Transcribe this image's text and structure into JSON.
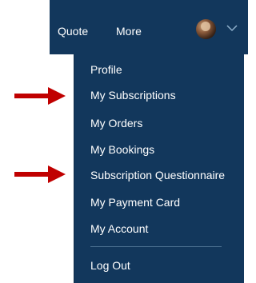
{
  "nav": {
    "quote": "Quote",
    "more": "More"
  },
  "menu": {
    "items": [
      "Profile",
      "My Subscriptions",
      "My Orders",
      "My Bookings",
      "Subscription Questionnaire",
      "My Payment Card",
      "My Account",
      "Log Out"
    ]
  },
  "colors": {
    "menu_background": "#12375c",
    "text": "#ffffff",
    "arrow": "#c00000"
  },
  "icons": {
    "avatar": "avatar",
    "chevron": "chevron-down-icon",
    "arrow": "red-arrow-icon"
  }
}
